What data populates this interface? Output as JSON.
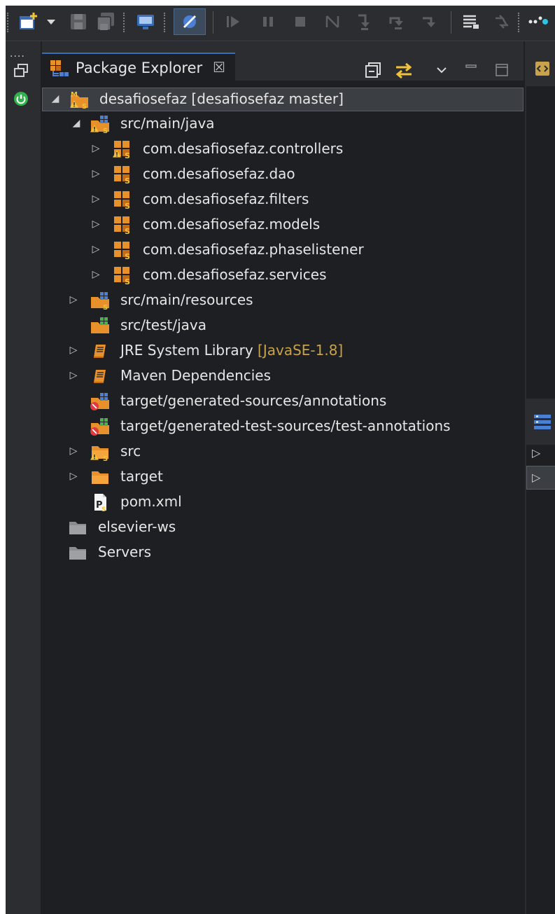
{
  "toolbar": {
    "icons": [
      "new-icon",
      "dropdown-arrow-icon",
      "save-icon",
      "save-all-icon",
      "console-icon",
      "skip-breakpoints-icon",
      "resume-icon",
      "suspend-icon",
      "terminate-icon",
      "disconnect-icon",
      "step-into-icon",
      "step-over-icon",
      "step-return-icon",
      "drop-to-frame-icon",
      "use-step-filters-icon"
    ]
  },
  "explorer": {
    "tab_title": "Package Explorer",
    "tab_close": "☒",
    "tree": {
      "project": {
        "label": "desafiosefaz [desafiosefaz master]"
      },
      "src_main_java": {
        "label": "src/main/java"
      },
      "packages": [
        {
          "label": "com.desafiosefaz.controllers",
          "warning": true
        },
        {
          "label": "com.desafiosefaz.dao",
          "warning": false
        },
        {
          "label": "com.desafiosefaz.filters",
          "warning": false
        },
        {
          "label": "com.desafiosefaz.models",
          "warning": false
        },
        {
          "label": "com.desafiosefaz.phaselistener",
          "warning": false
        },
        {
          "label": "com.desafiosefaz.services",
          "warning": false
        }
      ],
      "src_main_resources": {
        "label": "src/main/resources"
      },
      "src_test_java": {
        "label": "src/test/java"
      },
      "jre": {
        "label": "JRE System Library",
        "decoration": "[JavaSE-1.8]"
      },
      "maven": {
        "label": "Maven Dependencies"
      },
      "gen_sources": {
        "label": "target/generated-sources/annotations"
      },
      "gen_test_sources": {
        "label": "target/generated-test-sources/test-annotations"
      },
      "src": {
        "label": "src"
      },
      "target": {
        "label": "target"
      },
      "pom": {
        "label": "pom.xml"
      },
      "elsevier": {
        "label": "elsevier-ws"
      },
      "servers": {
        "label": "Servers"
      }
    }
  },
  "colors": {
    "background": "#1e1f22",
    "toolbar": "#2b2d31",
    "text": "#e6e6e6",
    "decoration": "#c9a24a",
    "package_orange": "#e8902a",
    "selection": "#3b3e43",
    "tab_accent": "#3a6fb5"
  }
}
